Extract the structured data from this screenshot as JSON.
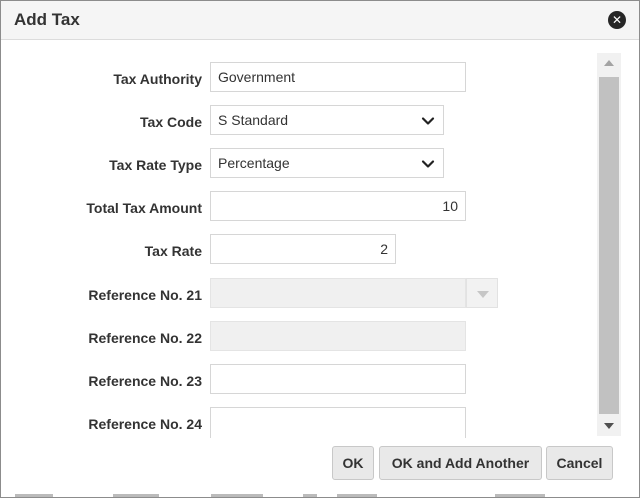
{
  "dialog": {
    "title": "Add Tax",
    "close_glyph": "✕"
  },
  "form": {
    "tax_authority": {
      "label": "Tax Authority",
      "value": "Government"
    },
    "tax_code": {
      "label": "Tax Code",
      "value": "S Standard"
    },
    "tax_rate_type": {
      "label": "Tax Rate Type",
      "value": "Percentage"
    },
    "total_tax_amount": {
      "label": "Total Tax Amount",
      "value": "10"
    },
    "tax_rate": {
      "label": "Tax Rate",
      "value": "2"
    },
    "reference_21": {
      "label": "Reference No. 21",
      "value": ""
    },
    "reference_22": {
      "label": "Reference No. 22",
      "value": ""
    },
    "reference_23": {
      "label": "Reference No. 23",
      "value": ""
    },
    "reference_24": {
      "label": "Reference No. 24",
      "value": ""
    }
  },
  "buttons": {
    "ok": "OK",
    "ok_add_another": "OK and Add Another",
    "cancel": "Cancel"
  },
  "icons": {
    "close": "close-icon",
    "select": "chevron-down-icon",
    "scroll_up": "scroll-up-arrow-icon",
    "scroll_down": "scroll-down-arrow-icon"
  },
  "colors": {
    "title_bar": "#f5f5f5",
    "button_bg": "#e9e9e9",
    "disabled_field": "#f0f0f0",
    "text": "#333333"
  }
}
